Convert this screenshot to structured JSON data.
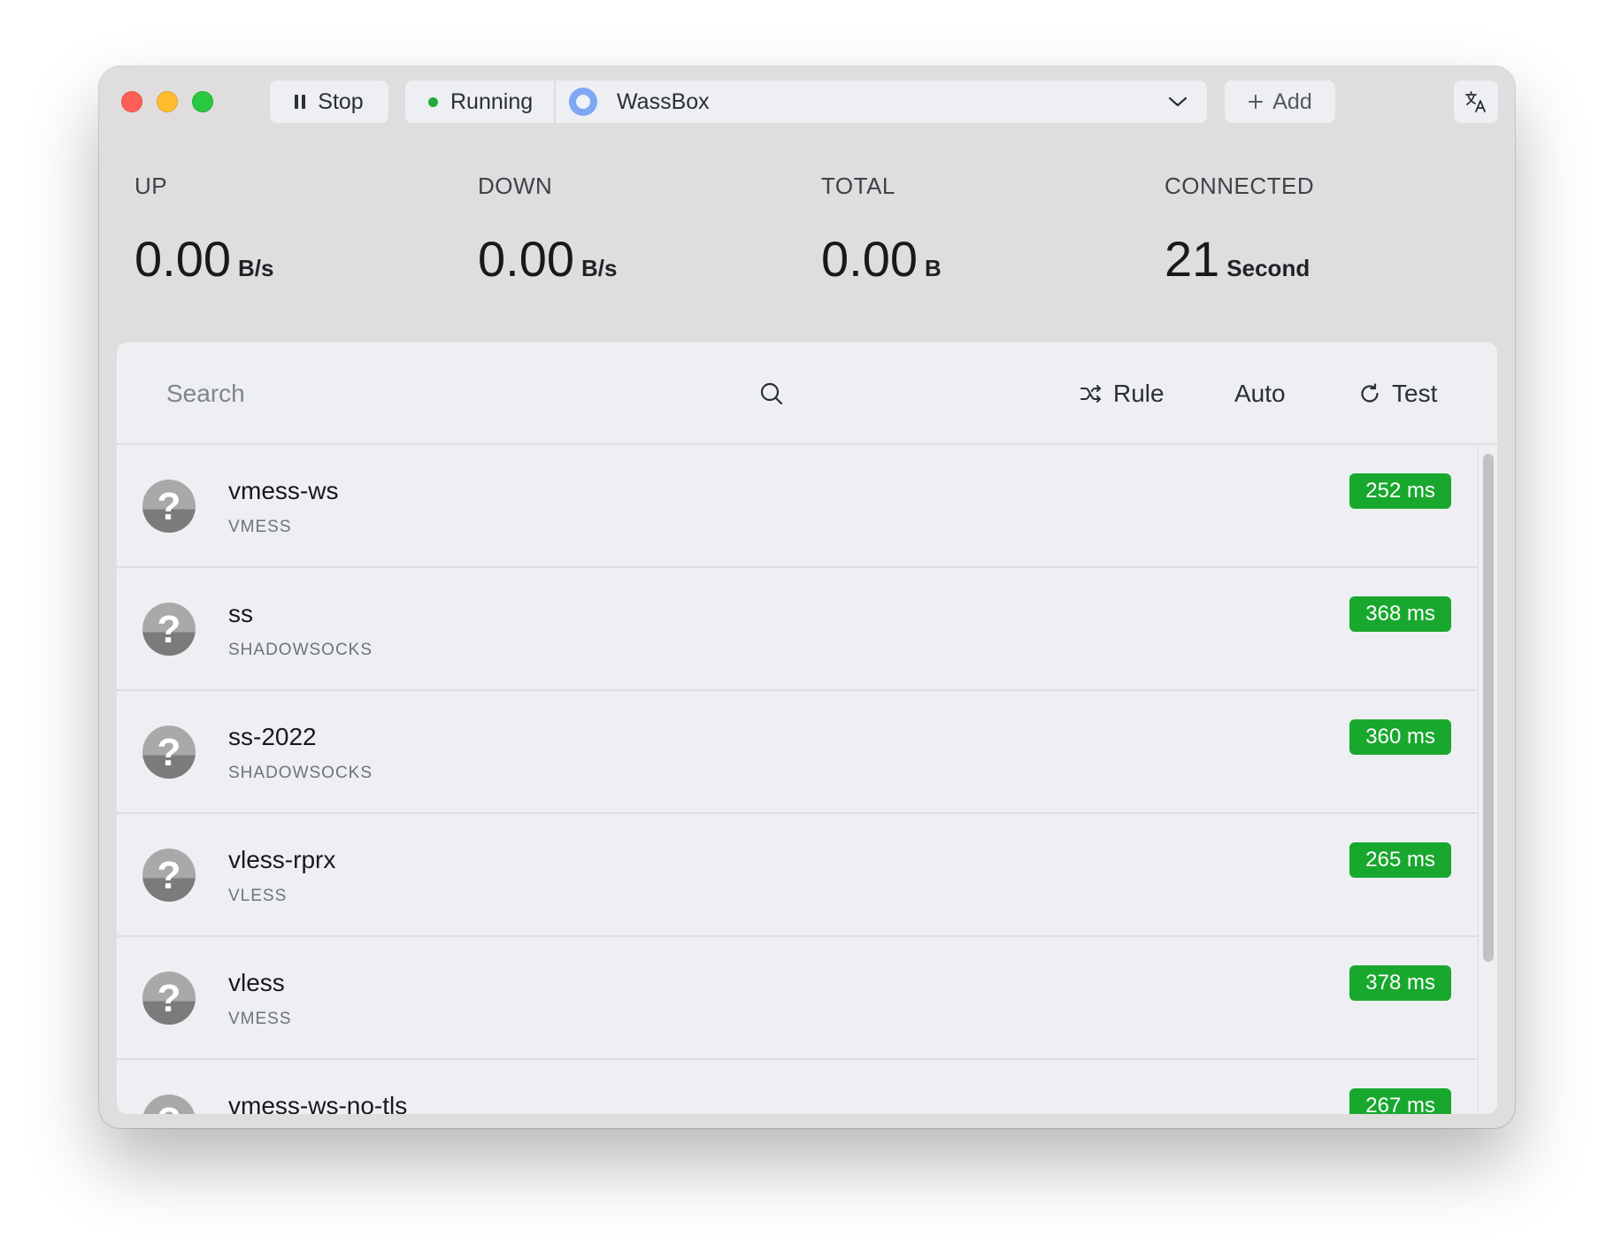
{
  "window": {
    "traffic_lights": {
      "close_color": "#ff5f57",
      "minimize_color": "#febc2e",
      "zoom_color": "#28c840"
    }
  },
  "toolbar": {
    "stop_label": "Stop",
    "status_label": "Running",
    "status_color": "#22a83a",
    "profile_name": "WassBox",
    "add_label": "Add",
    "add_icon": "plus-icon",
    "translate_icon": "translate-icon"
  },
  "stats": {
    "up": {
      "label": "UP",
      "value": "0.00",
      "unit": "B/s"
    },
    "down": {
      "label": "DOWN",
      "value": "0.00",
      "unit": "B/s"
    },
    "total": {
      "label": "TOTAL",
      "value": "0.00",
      "unit": "B"
    },
    "connected": {
      "label": "CONNECTED",
      "value": "21",
      "unit": "Second"
    }
  },
  "search": {
    "placeholder": "Search",
    "value": ""
  },
  "actions": {
    "rule_label": "Rule",
    "auto_label": "Auto",
    "test_label": "Test"
  },
  "latency_color": "#19a82e",
  "nodes": [
    {
      "name": "vmess-ws",
      "type": "VMESS",
      "latency": "252 ms"
    },
    {
      "name": "ss",
      "type": "SHADOWSOCKS",
      "latency": "368 ms"
    },
    {
      "name": "ss-2022",
      "type": "SHADOWSOCKS",
      "latency": "360 ms"
    },
    {
      "name": "vless-rprx",
      "type": "VLESS",
      "latency": "265 ms"
    },
    {
      "name": "vless",
      "type": "VMESS",
      "latency": "378 ms"
    },
    {
      "name": "vmess-ws-no-tls",
      "type": "",
      "latency": "267 ms"
    }
  ],
  "node_icon_glyph": "?"
}
